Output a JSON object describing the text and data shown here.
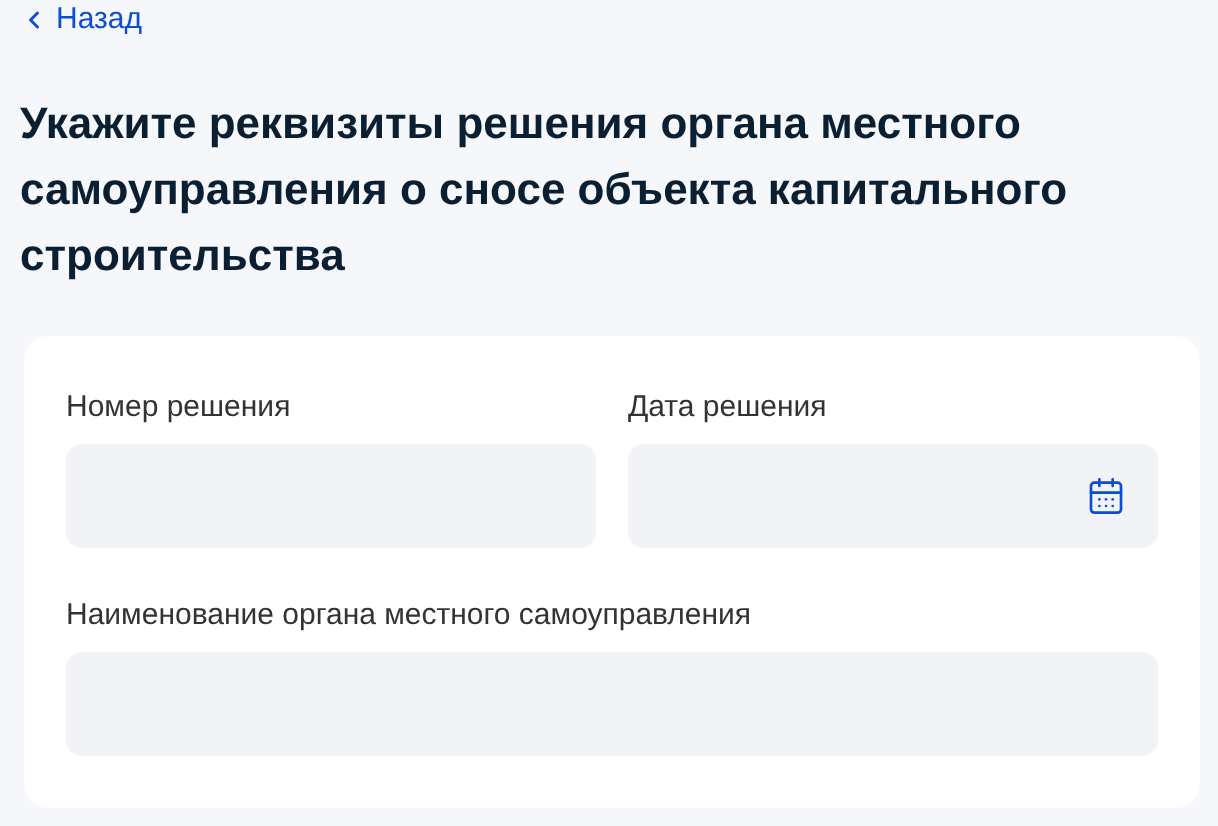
{
  "back_link": {
    "label": "Назад"
  },
  "heading": "Укажите реквизиты решения органа местного самоуправления о сносе объекта капитального строительства",
  "form": {
    "fields": [
      {
        "kind": "text",
        "label": "Номер решения"
      },
      {
        "kind": "date",
        "label": "Дата решения"
      },
      {
        "kind": "text",
        "label": "Наименование органа местного самоуправления"
      }
    ]
  }
}
